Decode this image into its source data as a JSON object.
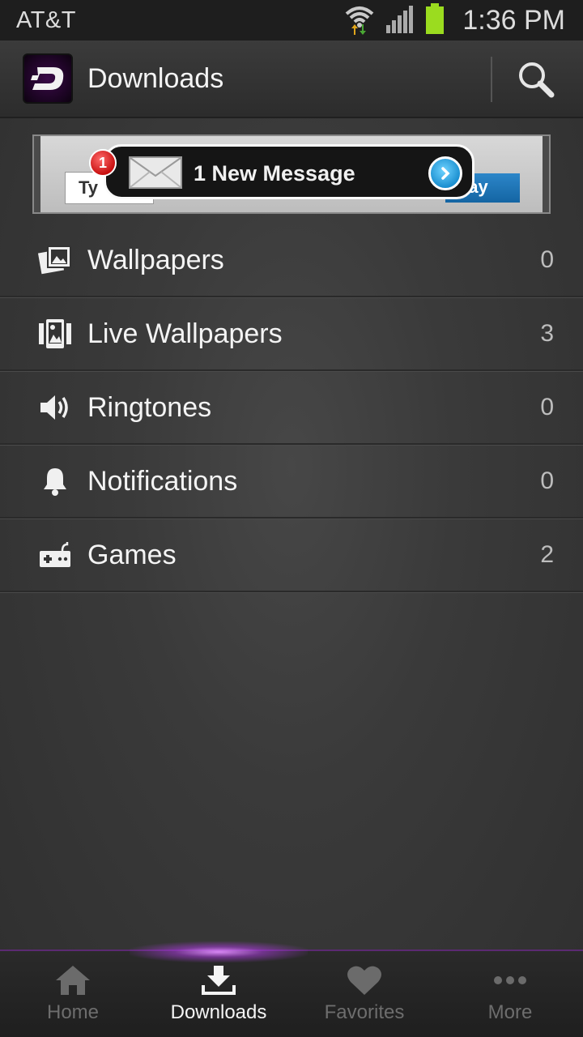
{
  "status_bar": {
    "carrier": "AT&T",
    "time": "1:36 PM",
    "icons": [
      "wifi-icon",
      "signal-icon",
      "battery-icon"
    ]
  },
  "action_bar": {
    "title": "Downloads",
    "logo_icon": "zedge-d-logo",
    "search_icon": "search-icon"
  },
  "ad": {
    "badge_count": "1",
    "message": "1 New Message",
    "input_text": "Ty",
    "button_text": "kay",
    "colors": {
      "button": "#1a78bd",
      "badge": "#d31414"
    }
  },
  "list": {
    "items": [
      {
        "label": "Wallpapers",
        "count": "0",
        "icon": "wallpapers-icon"
      },
      {
        "label": "Live Wallpapers",
        "count": "3",
        "icon": "live-wallpapers-icon"
      },
      {
        "label": "Ringtones",
        "count": "0",
        "icon": "speaker-icon"
      },
      {
        "label": "Notifications",
        "count": "0",
        "icon": "bell-icon"
      },
      {
        "label": "Games",
        "count": "2",
        "icon": "gamepad-icon"
      }
    ]
  },
  "bottom_nav": {
    "accent": "#b04ae0",
    "items": [
      {
        "label": "Home",
        "icon": "home-icon",
        "active": false
      },
      {
        "label": "Downloads",
        "icon": "download-icon",
        "active": true
      },
      {
        "label": "Favorites",
        "icon": "heart-icon",
        "active": false
      },
      {
        "label": "More",
        "icon": "more-dots-icon",
        "active": false
      }
    ]
  }
}
